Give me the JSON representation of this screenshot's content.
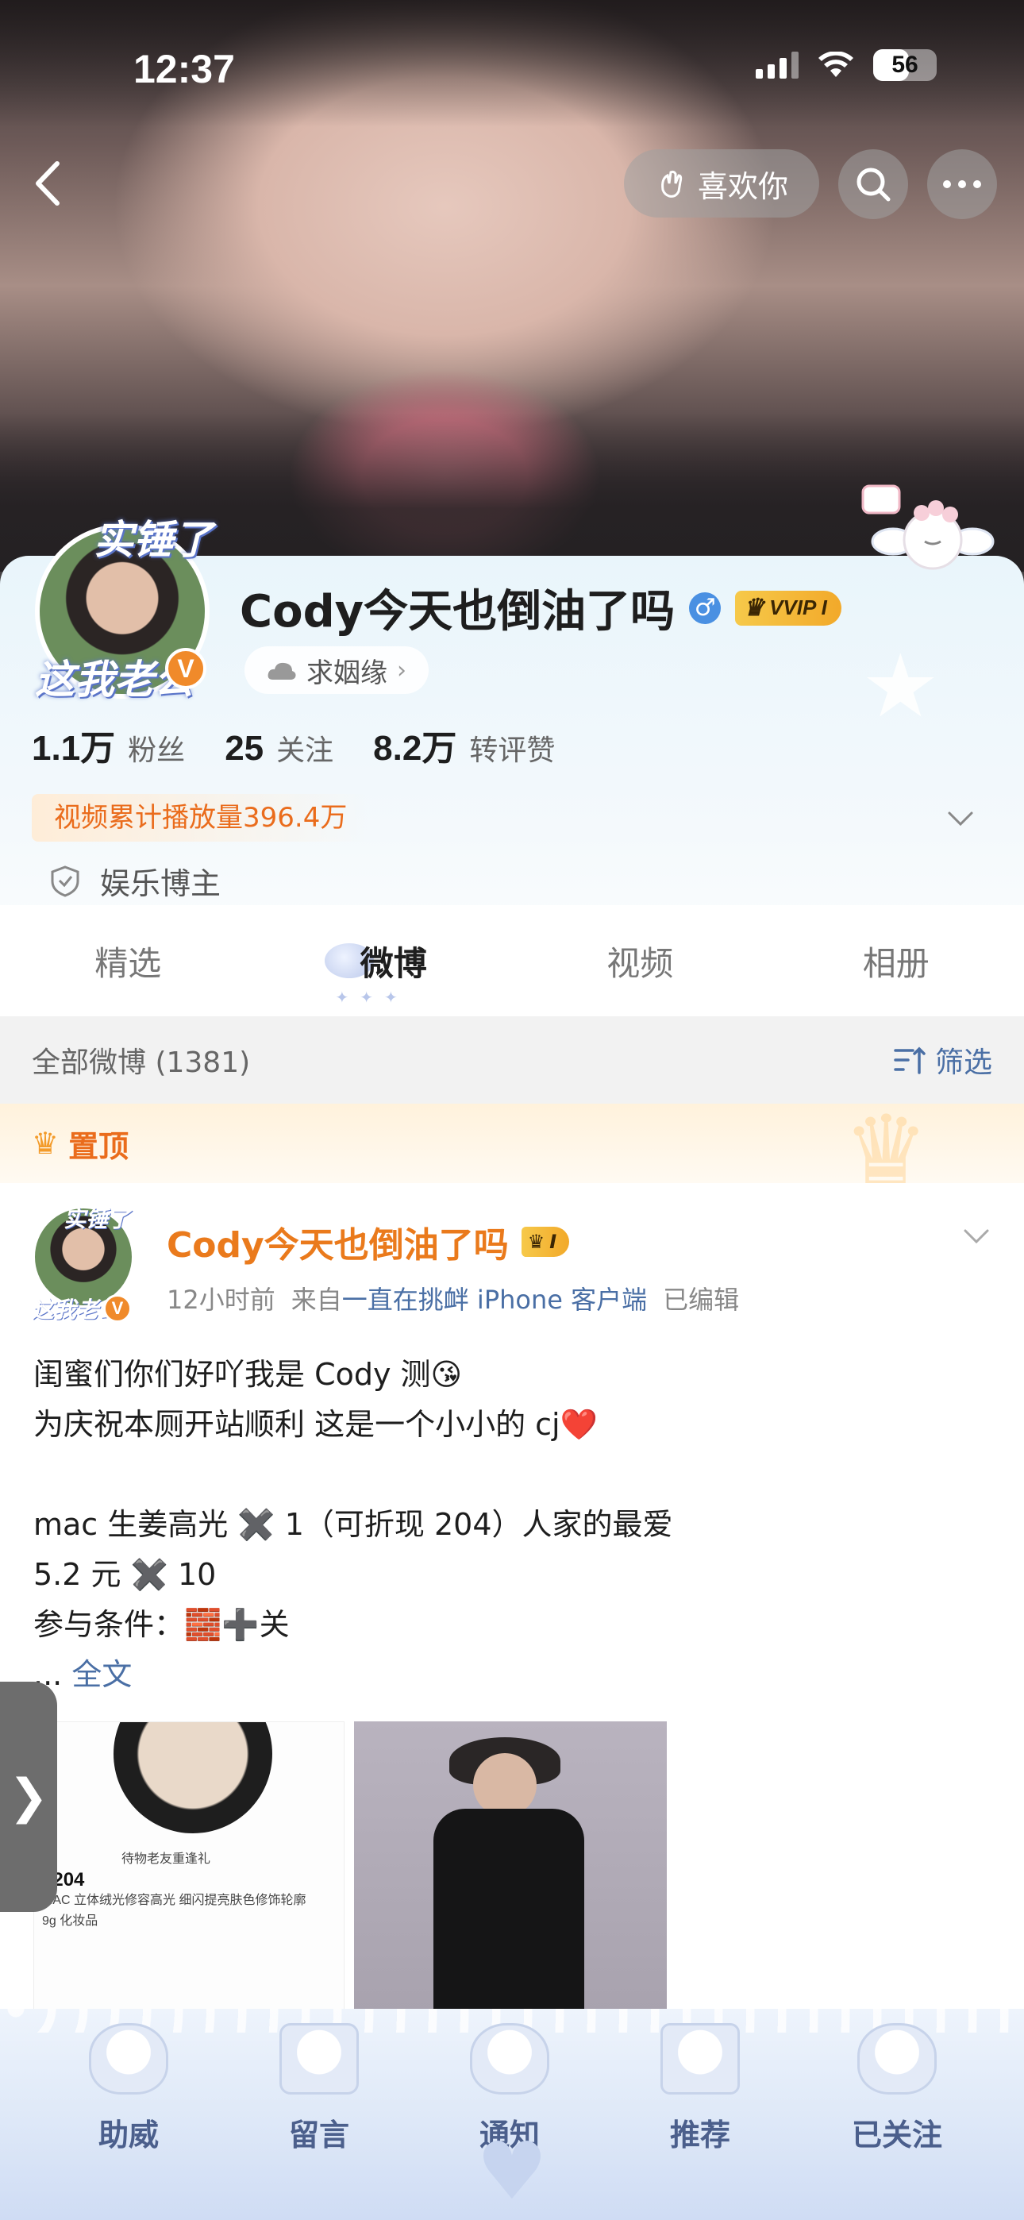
{
  "status_bar": {
    "time": "12:37",
    "battery": "56",
    "battery_level": 0.56
  },
  "header": {
    "like_label": "喜欢你"
  },
  "profile": {
    "name": "Cody今天也倒油了吗",
    "vip_label": "VVIP I",
    "avatar_text_top": "实锤了",
    "avatar_text_bottom": "这我老公",
    "verified_badge": "V",
    "tag_chip": "求姻缘",
    "stats": [
      {
        "num": "1.1万",
        "label": "粉丝"
      },
      {
        "num": "25",
        "label": "关注"
      },
      {
        "num": "8.2万",
        "label": "转评赞"
      }
    ],
    "play_count": "视频累计播放量396.4万",
    "category": "娱乐博主"
  },
  "tabs": [
    "精选",
    "微博",
    "视频",
    "相册"
  ],
  "active_tab": "微博",
  "filter": {
    "title": "全部微博 (1381)",
    "button": "筛选"
  },
  "pinned": {
    "label": "置顶"
  },
  "post": {
    "author": "Cody今天也倒油了吗",
    "vip_label": "I",
    "avatar_text_top": "实锤了",
    "avatar_text_bottom": "这我老公",
    "time": "12小时前",
    "source_prefix": "来自",
    "source": "一直在挑衅 iPhone 客户端",
    "edited": "已编辑",
    "lines": [
      "闺蜜们你们好吖我是 Cody 测😘",
      "为庆祝本厕开站顺利 这是一个小小的 cj❤️",
      "",
      "mac 生姜高光 ✖️ 1（可折现 204）人家的最爱",
      "5.2 元 ✖️ 10",
      "参与条件：🧱➕关"
    ],
    "more_prefix": "... ",
    "more_link": "全文",
    "image1_text": [
      "待物老友重逢礼",
      "¥204",
      "MAC 立体绒光修容高光 细闪提亮肤色修饰轮廓",
      "9g 化妆品"
    ]
  },
  "side_handle": "❯",
  "bottom_bar": [
    "助威",
    "留言",
    "通知",
    "推荐",
    "已关注"
  ],
  "colors": {
    "accent_orange": "#ea6c1c",
    "link_blue": "#4a6fa5",
    "vip_gold": "#f6c94a"
  }
}
